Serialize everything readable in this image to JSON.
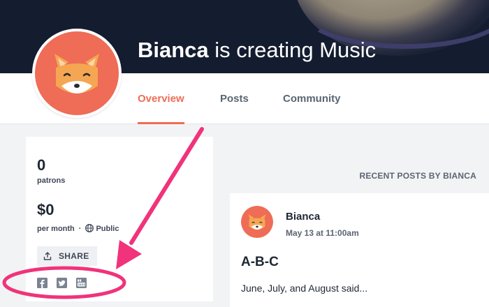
{
  "colors": {
    "accent": "#ef6c56",
    "annotation": "#f0337a",
    "banner": "#141d30"
  },
  "header": {
    "creator_name": "Bianca",
    "title_suffix": "is creating Music"
  },
  "tabs": [
    {
      "label": "Overview",
      "active": true
    },
    {
      "label": "Posts",
      "active": false
    },
    {
      "label": "Community",
      "active": false
    }
  ],
  "sidebar": {
    "patrons_value": "0",
    "patrons_label": "patrons",
    "earnings_value": "$0",
    "earnings_period": "per month",
    "separator": "·",
    "visibility": "Public",
    "share_label": "SHARE",
    "social_icons": [
      "facebook-icon",
      "twitter-icon",
      "youtube-icon"
    ]
  },
  "recent_posts": {
    "heading": "RECENT POSTS BY BIANCA",
    "posts": [
      {
        "author": "Bianca",
        "date": "May 13 at 11:00am",
        "title": "A-B-C",
        "excerpt": "June, July, and August said..."
      }
    ]
  }
}
